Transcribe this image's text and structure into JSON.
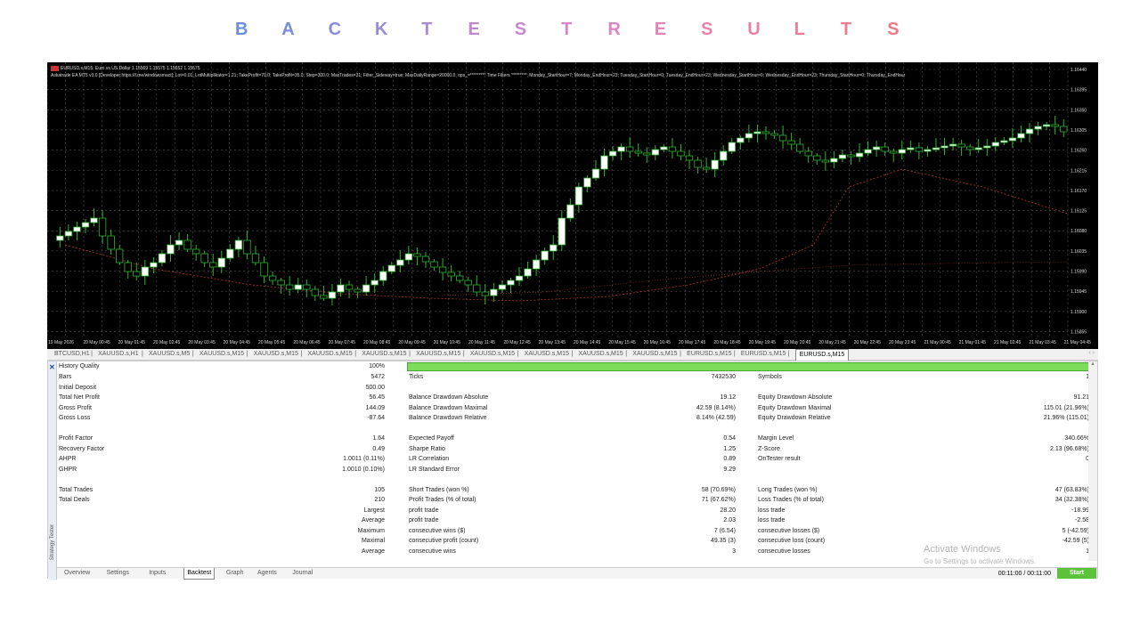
{
  "heading": {
    "letters": [
      "B",
      "A",
      "C",
      "K",
      "T",
      "E",
      "S",
      "T",
      "R",
      "E",
      "S",
      "U",
      "L",
      "T",
      "S"
    ],
    "colors": [
      "#6b8fd6",
      "#7a8dd8",
      "#8a8cd6",
      "#998bd4",
      "#ab8ad2",
      "#bc88d0",
      "#c987cc",
      "#d686c8",
      "#dd85c0",
      "#e283b8",
      "#e681ae",
      "#e97fa4",
      "#eb7d9a",
      "#ec7c90",
      "#ed7a86"
    ]
  },
  "chart": {
    "symbol_line": "EURUSD.s,M15:  Euro vs US Dollar  1.15569 1.15575 1.15552 1.15575",
    "ea_line": "Askatrade EA MT5 v3.0 [Developer:https://t.me/windowsmact]; Lot=0.01; LotMultiplikator=1.21; TakeProfit=70.0; TakeProfit=35.0; Step=300.0; MaxTrades=31; Filter_Sideway=true; MaxDailyRange=20000.0; ops_=********* Time Filters *********; Monday_StartHour=7; Monday_EndHour=23; Tuesday_StartHour=0; Tuesday_EndHour=23; Wednesday_StartHour=0; Wednesday_EndHour=23; Thursday_StartHour=0; Thursday_EndHour",
    "price_labels": [
      "1.16440",
      "1.16395",
      "1.16350",
      "1.16305",
      "1.16260",
      "1.16215",
      "1.16170",
      "1.16125",
      "1.16080",
      "1.16035",
      "1.15990",
      "1.15945",
      "1.15900",
      "1.15855"
    ],
    "time_labels": [
      "19 May 2026",
      "20 May 00:45",
      "20 May 01:45",
      "20 May 02:45",
      "20 May 03:45",
      "20 May 04:45",
      "20 May 05:45",
      "20 May 06:45",
      "20 May 07:45",
      "20 May 08:45",
      "20 May 09:45",
      "20 May 10:45",
      "20 May 11:45",
      "20 May 12:45",
      "20 May 13:45",
      "20 May 14:45",
      "20 May 15:45",
      "20 May 16:45",
      "20 May 17:45",
      "20 May 18:45",
      "20 May 19:45",
      "20 May 20:45",
      "20 May 21:45",
      "20 May 22:45",
      "20 May 23:45",
      "21 May 00:45",
      "21 May 01:45",
      "21 May 02:45",
      "21 May 03:45",
      "21 May 04:45"
    ],
    "colors": {
      "bg": "#000000",
      "grid": "#555555",
      "candle": "#2fb52f",
      "candle_bull_fill": "#ffffff",
      "ma": "#b0332a"
    },
    "chart_tabs": [
      "BTCUSD,H1",
      "XAUUSD.s,H1",
      "XAUUSD.s,M5",
      "XAUUSD.s,M15",
      "XAUUSD.s,M15",
      "XAUUSD.s,M15",
      "XAUUSD.s,M15",
      "XAUUSD.s,M15",
      "XAUUSD.s,M15",
      "XAUUSD.s,M15",
      "XAUUSD.s,M15",
      "XAUUSD.s,M15",
      "EURUSD.s,M15",
      "EURUSD.s,M15",
      "EURUSD.s,M15"
    ]
  },
  "report": {
    "history_quality_label": "History Quality",
    "history_quality": "100%",
    "rows": [
      [
        "Bars",
        "5472",
        "Ticks",
        "7432530",
        "Symbols",
        "1"
      ],
      [
        "Initial Deposit",
        "500.00",
        "",
        "",
        "",
        ""
      ],
      [
        "Total Net Profit",
        "56.45",
        "Balance Drawdown Absolute",
        "19.12",
        "Equity Drawdown Absolute",
        "91.21"
      ],
      [
        "Gross Profit",
        "144.09",
        "Balance Drawdown Maximal",
        "42.59 (8.14%)",
        "Equity Drawdown Maximal",
        "115.01 (21.96%)"
      ],
      [
        "Gross Loss",
        "-87.64",
        "Balance Drawdown Relative",
        "8.14% (42.59)",
        "Equity Drawdown Relative",
        "21.96% (115.01)"
      ],
      [
        "",
        "",
        "",
        "",
        "",
        ""
      ],
      [
        "Profit Factor",
        "1.64",
        "Expected Payoff",
        "0.54",
        "Margin Level",
        "340.66%"
      ],
      [
        "Recovery Factor",
        "0.49",
        "Sharpe Ratio",
        "1.25",
        "Z-Score",
        "2.13 (96.68%)"
      ],
      [
        "AHPR",
        "1.0011 (0.11%)",
        "LR Correlation",
        "0.89",
        "OnTester result",
        "0"
      ],
      [
        "GHPR",
        "1.0010 (0.10%)",
        "LR Standard Error",
        "9.29",
        "",
        ""
      ],
      [
        "",
        "",
        "",
        "",
        "",
        ""
      ],
      [
        "Total Trades",
        "105",
        "Short Trades (won %)",
        "58 (70.69%)",
        "Long Trades (won %)",
        "47 (63.83%)"
      ],
      [
        "Total Deals",
        "210",
        "Profit Trades (% of total)",
        "71 (67.62%)",
        "Loss Trades (% of total)",
        "34 (32.38%)"
      ],
      [
        "",
        "Largest",
        "profit trade",
        "28.20",
        "loss trade",
        "-18.99"
      ],
      [
        "",
        "Average",
        "profit trade",
        "2.03",
        "loss trade",
        "-2.58"
      ],
      [
        "",
        "Maximum",
        "consecutive wins ($)",
        "7 (6.54)",
        "consecutive losses ($)",
        "5 (-42.59)"
      ],
      [
        "",
        "Maximal",
        "consecutive profit (count)",
        "49.35 (3)",
        "consecutive loss (count)",
        "-42.59 (5)"
      ],
      [
        "",
        "Average",
        "consecutive wins",
        "3",
        "consecutive losses",
        "1"
      ]
    ]
  },
  "bottom_tabs": [
    "Overview",
    "Settings",
    "Inputs",
    "Backtest",
    "Graph",
    "Agents",
    "Journal"
  ],
  "active_bottom_tab": "Backtest",
  "elapsed": "00:11:00 / 00:11:00",
  "start_label": "Start",
  "side_label": "Strategy Tester",
  "close_glyph": "✕",
  "activation": {
    "title": "Activate Windows",
    "sub": "Go to Settings to activate Windows."
  }
}
